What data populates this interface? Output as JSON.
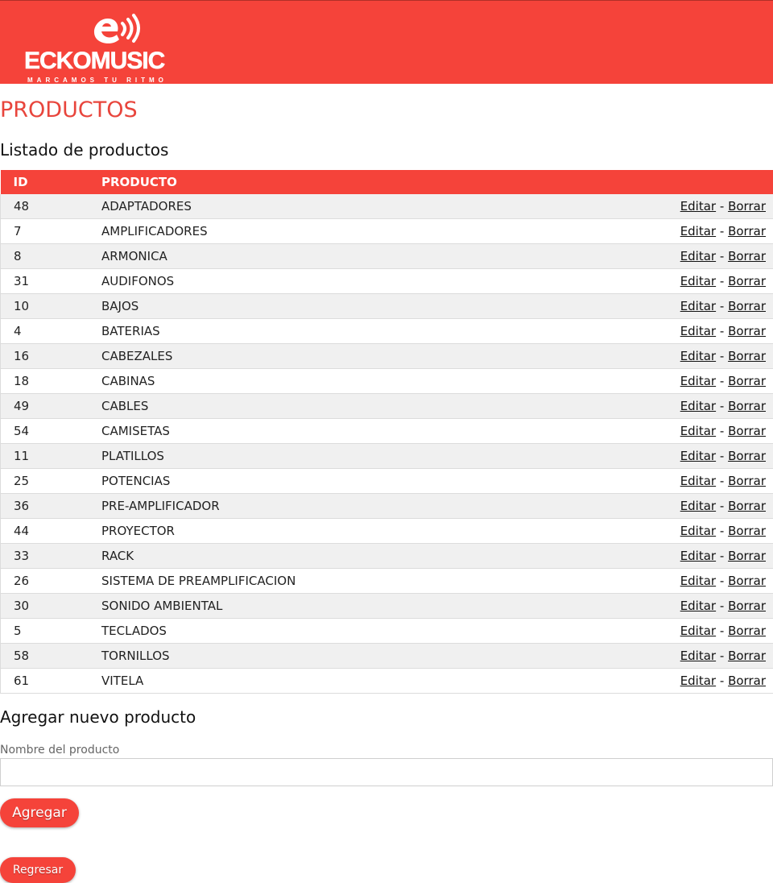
{
  "header": {
    "logo_text": "ECKOMUSIC",
    "logo_tagline": "MARCAMOS TU RITMO",
    "brand_color": "#f5433a"
  },
  "page_title": "PRODUCTOS",
  "list_title": "Listado de productos",
  "table": {
    "columns": [
      "ID",
      "PRODUCTO"
    ],
    "edit_label": "Editar",
    "separator": "-",
    "delete_label": "Borrar",
    "rows": [
      {
        "id": "48",
        "name": "ADAPTADORES"
      },
      {
        "id": "7",
        "name": "AMPLIFICADORES"
      },
      {
        "id": "8",
        "name": "ARMONICA"
      },
      {
        "id": "31",
        "name": "AUDIFONOS"
      },
      {
        "id": "10",
        "name": "BAJOS"
      },
      {
        "id": "4",
        "name": "BATERIAS"
      },
      {
        "id": "16",
        "name": "CABEZALES"
      },
      {
        "id": "18",
        "name": "CABINAS"
      },
      {
        "id": "49",
        "name": "CABLES"
      },
      {
        "id": "54",
        "name": "CAMISETAS"
      },
      {
        "id": "11",
        "name": "PLATILLOS"
      },
      {
        "id": "25",
        "name": "POTENCIAS"
      },
      {
        "id": "36",
        "name": "PRE-AMPLIFICADOR"
      },
      {
        "id": "44",
        "name": "PROYECTOR"
      },
      {
        "id": "33",
        "name": "RACK"
      },
      {
        "id": "26",
        "name": "SISTEMA DE PREAMPLIFICACION"
      },
      {
        "id": "30",
        "name": "SONIDO AMBIENTAL"
      },
      {
        "id": "5",
        "name": "TECLADOS"
      },
      {
        "id": "58",
        "name": "TORNILLOS"
      },
      {
        "id": "61",
        "name": "VITELA"
      }
    ]
  },
  "add_form": {
    "title": "Agregar nuevo producto",
    "name_label": "Nombre del producto",
    "name_value": "",
    "submit_label": "Agregar"
  },
  "back_label": "Regresar"
}
